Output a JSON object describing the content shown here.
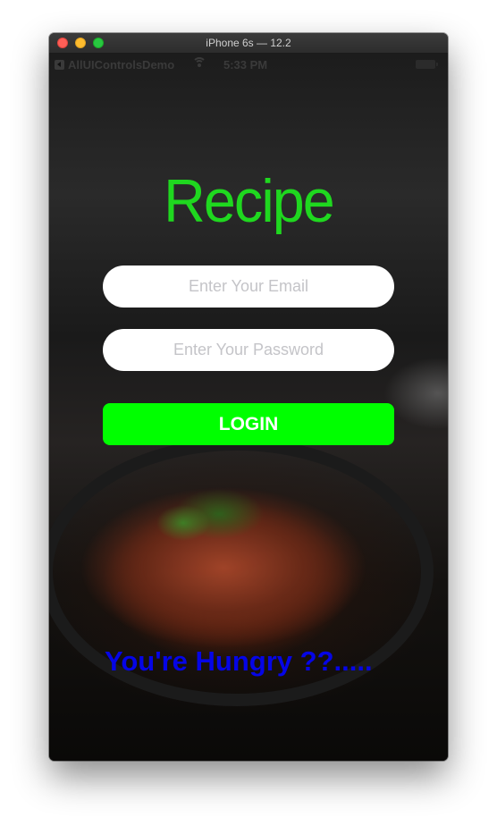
{
  "window": {
    "title": "iPhone 6s — 12.2"
  },
  "status_bar": {
    "back_app": "AllUIControlsDemo",
    "time": "5:33 PM",
    "icons": [
      "back-icon",
      "wifi-icon",
      "battery-icon"
    ]
  },
  "app": {
    "title": "Recipe",
    "title_color": "#1fd81f",
    "email": {
      "placeholder": "Enter Your Email",
      "value": ""
    },
    "password": {
      "placeholder": "Enter Your Password",
      "value": ""
    },
    "login_label": "LOGIN",
    "login_color": "#00ff00",
    "tagline": "You're Hungry ??.....",
    "tagline_color": "#0505e6"
  }
}
